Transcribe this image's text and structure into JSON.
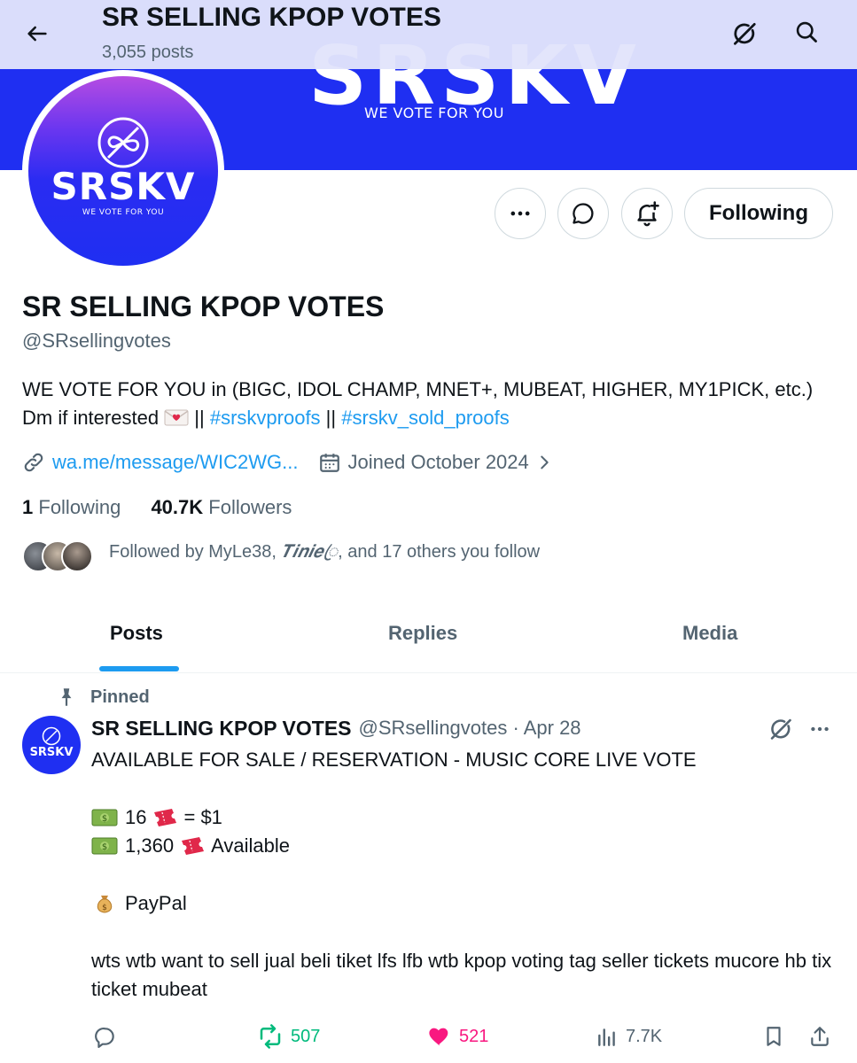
{
  "banner": {
    "logo_text": "SRSKV",
    "tagline": "WE VOTE FOR YOU"
  },
  "header": {
    "title": "SR SELLING KPOP VOTES",
    "post_count": "3,055 posts"
  },
  "avatar": {
    "logo_text": "SRSKV",
    "tagline": "WE VOTE FOR YOU"
  },
  "actions": {
    "following_label": "Following"
  },
  "profile": {
    "name": "SR SELLING KPOP VOTES",
    "handle": "@SRsellingvotes",
    "bio_text": "WE VOTE FOR YOU in (BIGC, IDOL CHAMP, MNET+, MUBEAT, HIGHER, MY1PICK, etc.) Dm if interested",
    "bio_sep1": " || ",
    "bio_tag1": "#srskvproofs",
    "bio_sep2": " || ",
    "bio_tag2": "#srskv_sold_proofs",
    "link": "wa.me/message/WIC2WG...",
    "joined": "Joined October 2024",
    "following_count": "1",
    "following_label": "Following",
    "followers_count": "40.7K",
    "followers_label": "Followers",
    "followed_by_prefix": "Followed by MyLe38,",
    "followed_by_fancy": "𝑻𝒊𝒏𝒊𝒆ꦿ",
    "followed_by_suffix": ", and 17 others you follow"
  },
  "tabs": [
    {
      "label": "Posts",
      "active": true
    },
    {
      "label": "Replies",
      "active": false
    },
    {
      "label": "Media",
      "active": false
    }
  ],
  "post": {
    "pinned_label": "Pinned",
    "avatar_text": "SRSKV",
    "author_name": "SR SELLING KPOP VOTES",
    "author_meta": "@SRsellingvotes · Apr 28",
    "line1": "AVAILABLE FOR SALE / RESERVATION - MUSIC CORE LIVE VOTE",
    "line2a": "16",
    "line2b": "= $1",
    "line3a": "1,360",
    "line3b": "Available",
    "line4": "PayPal",
    "line5": "wts wtb want to sell jual beli tiket lfs lfb wtb kpop voting tag seller tickets mucore hb tix ticket mubeat",
    "retweets": "507",
    "likes": "521",
    "views": "7.7K"
  },
  "icons": {
    "back": "arrow-left-icon",
    "grok": "grok-icon",
    "search": "search-icon",
    "more": "more-dots-icon",
    "message": "message-icon",
    "notify": "bell-plus-icon",
    "link": "link-icon",
    "calendar": "calendar-icon",
    "pin": "pin-icon",
    "reply": "reply-icon",
    "retweet": "retweet-icon",
    "like": "heart-icon",
    "views": "views-icon",
    "bookmark": "bookmark-icon",
    "share": "share-icon"
  },
  "colors": {
    "banner": "#1f2ff2",
    "accent": "#1d9bf0",
    "retweet": "#00ba7c",
    "like": "#f91880",
    "secondary": "#536471"
  }
}
